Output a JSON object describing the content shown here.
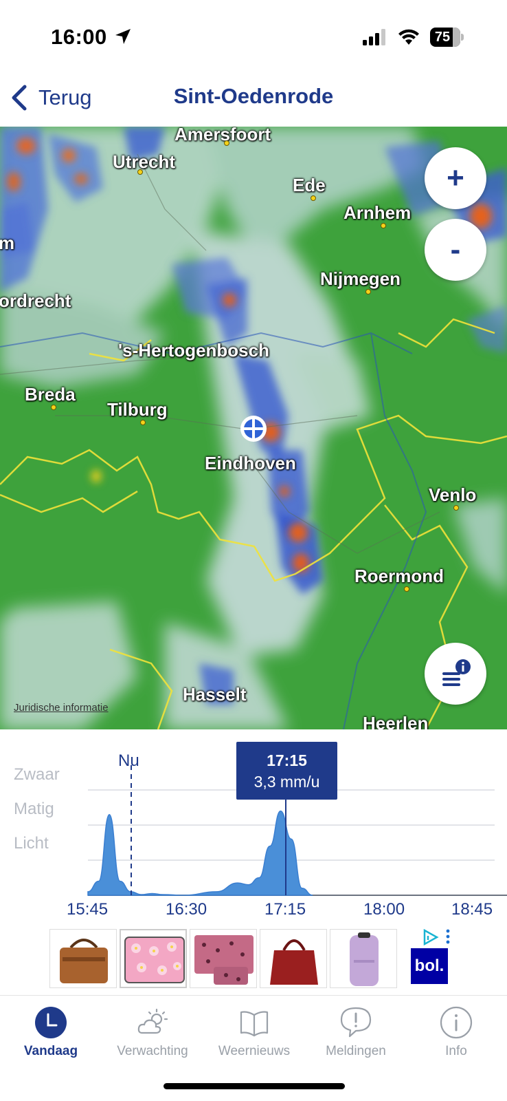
{
  "status_bar": {
    "time": "16:00",
    "battery": "75",
    "battery_level": 0.75
  },
  "header": {
    "back_label": "Terug",
    "title": "Sint-Oedenrode"
  },
  "map": {
    "cities": {
      "amersfoort": "Amersfoort",
      "utrecht": "Utrecht",
      "ede": "Ede",
      "arnhem": "Arnhem",
      "nijmegen": "Nijmegen",
      "dordrecht": "ordrecht",
      "m_edge": "m",
      "s_hertogenbosch": "'s-Hertogenbosch",
      "breda": "Breda",
      "tilburg": "Tilburg",
      "eindhoven": "Eindhoven",
      "venlo": "Venlo",
      "roermond": "Roermond",
      "hasselt": "Hasselt",
      "heerlen": "Heerlen"
    },
    "zoom_in_label": "+",
    "zoom_out_label": "-",
    "legal_link": "Juridische informatie"
  },
  "chart": {
    "y_levels": [
      "Zwaar",
      "Matig",
      "Licht"
    ],
    "x_ticks": [
      "15:45",
      "16:30",
      "17:15",
      "18:00",
      "18:45"
    ],
    "now_label": "Nu",
    "tooltip": {
      "time": "17:15",
      "value": "3,3 mm/u"
    }
  },
  "chart_data": {
    "type": "area",
    "title": "",
    "xlabel": "",
    "ylabel": "",
    "x_ticks": [
      "15:45",
      "16:30",
      "17:15",
      "18:00",
      "18:45"
    ],
    "y_categories": [
      "Licht",
      "Matig",
      "Zwaar"
    ],
    "now_marker": "16:05",
    "selected": {
      "time": "17:15",
      "value": "3,3 mm/u"
    },
    "series": [
      {
        "x": [
          "15:45",
          "15:50",
          "15:55",
          "16:00",
          "16:05",
          "16:10",
          "16:15",
          "16:20",
          "16:30",
          "16:45",
          "16:55",
          "17:00",
          "17:05",
          "17:10",
          "17:15",
          "17:20",
          "17:25",
          "17:30"
        ],
        "values": [
          0.1,
          0.4,
          2.3,
          0.4,
          0.1,
          0.02,
          0.05,
          0.02,
          0.0,
          0.1,
          0.35,
          0.3,
          0.5,
          1.4,
          2.4,
          1.6,
          0.2,
          0.0
        ]
      }
    ],
    "x_range_minutes": [
      0,
      190
    ]
  },
  "ads": {
    "bol_label": "bol."
  },
  "tab_bar": {
    "tabs": [
      {
        "label": "Vandaag",
        "icon": "clock-icon",
        "active": true
      },
      {
        "label": "Verwachting",
        "icon": "partly-cloudy-icon",
        "active": false
      },
      {
        "label": "Weernieuws",
        "icon": "book-icon",
        "active": false
      },
      {
        "label": "Meldingen",
        "icon": "alert-bubble-icon",
        "active": false
      },
      {
        "label": "Info",
        "icon": "info-icon",
        "active": false
      }
    ]
  },
  "colors": {
    "brand_blue": "#1f3a8a",
    "map_green": "#3aa33a",
    "rain_blue": "#3b62d6",
    "rain_orange": "#e06020",
    "chart_fill": "#4a8fd8"
  }
}
